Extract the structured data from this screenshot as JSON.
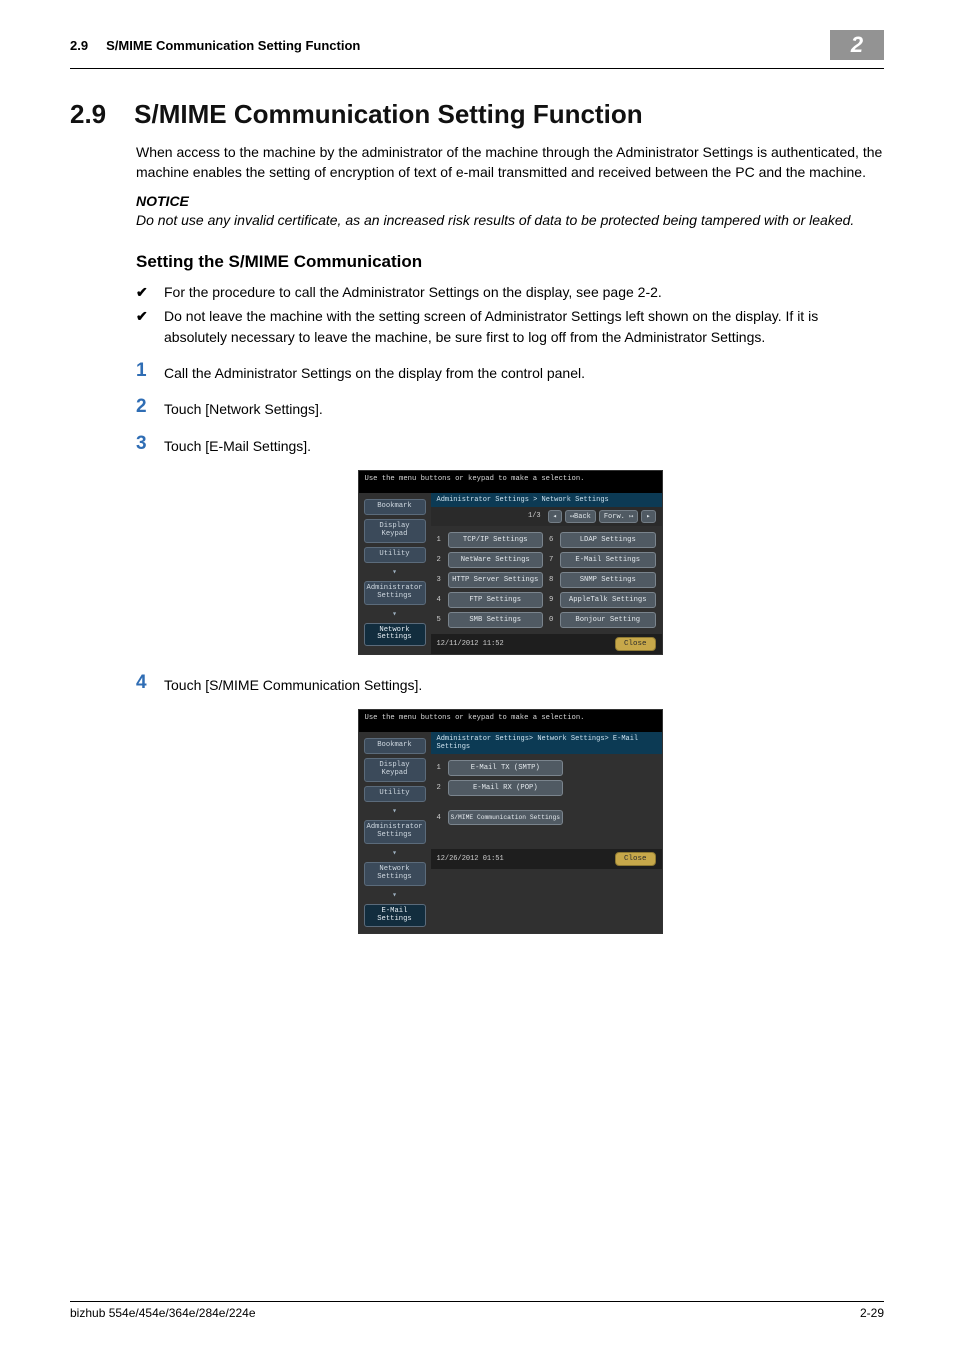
{
  "header": {
    "section_ref": "2.9",
    "section_name": "S/MIME Communication Setting Function",
    "chapter_badge": "2"
  },
  "title": {
    "number": "2.9",
    "text": "S/MIME Communication Setting Function"
  },
  "intro_para": "When access to the machine by the administrator of the machine through the Administrator Settings is authenticated, the machine enables the setting of encryption of text of e-mail transmitted and received between the PC and the machine.",
  "notice": {
    "label": "NOTICE",
    "body": "Do not use any invalid certificate, as an increased risk results of data to be protected being tampered with or leaked."
  },
  "subheading": "Setting the S/MIME Communication",
  "checks": [
    "For the procedure to call the Administrator Settings on the display, see page 2-2.",
    "Do not leave the machine with the setting screen of Administrator Settings left shown on the display. If it is absolutely necessary to leave the machine, be sure first to log off from the Administrator Settings."
  ],
  "steps": [
    {
      "n": "1",
      "t": "Call the Administrator Settings on the display from the control panel."
    },
    {
      "n": "2",
      "t": "Touch [Network Settings]."
    },
    {
      "n": "3",
      "t": "Touch [E-Mail Settings]."
    },
    {
      "n": "4",
      "t": "Touch [S/MIME Communication Settings]."
    }
  ],
  "shot1": {
    "hint": "Use the menu buttons or keypad to make a selection.",
    "side_buttons": [
      "Bookmark",
      "Display Keypad",
      "Utility",
      "Administrator Settings",
      "Network Settings"
    ],
    "crumb": "Administrator Settings > Network Settings",
    "pager": {
      "page": "1/3",
      "back": "↤Back",
      "fwd": "Forw.  ↦"
    },
    "options_left": [
      {
        "n": "1",
        "l": "TCP/IP Settings"
      },
      {
        "n": "2",
        "l": "NetWare Settings"
      },
      {
        "n": "3",
        "l": "HTTP Server Settings"
      },
      {
        "n": "4",
        "l": "FTP Settings"
      },
      {
        "n": "5",
        "l": "SMB Settings"
      }
    ],
    "options_right": [
      {
        "n": "6",
        "l": "LDAP Settings"
      },
      {
        "n": "7",
        "l": "E-Mail Settings"
      },
      {
        "n": "8",
        "l": "SNMP Settings"
      },
      {
        "n": "9",
        "l": "AppleTalk Settings"
      },
      {
        "n": "0",
        "l": "Bonjour Setting"
      }
    ],
    "timestamp": "12/11/2012   11:52",
    "close": "Close"
  },
  "shot2": {
    "hint": "Use the menu buttons or keypad to make a selection.",
    "side_buttons": [
      "Bookmark",
      "Display Keypad",
      "Utility",
      "Administrator Settings",
      "Network Settings",
      "E-Mail Settings"
    ],
    "crumb": "Administrator Settings> Network Settings> E-Mail Settings",
    "options": [
      {
        "n": "1",
        "l": "E-Mail TX (SMTP)"
      },
      {
        "n": "2",
        "l": "E-Mail RX (POP)"
      },
      {
        "n": "4",
        "l": "S/MIME Communication Settings"
      }
    ],
    "timestamp": "12/26/2012   01:51",
    "close": "Close"
  },
  "footer": {
    "left": "bizhub 554e/454e/364e/284e/224e",
    "right": "2-29"
  }
}
